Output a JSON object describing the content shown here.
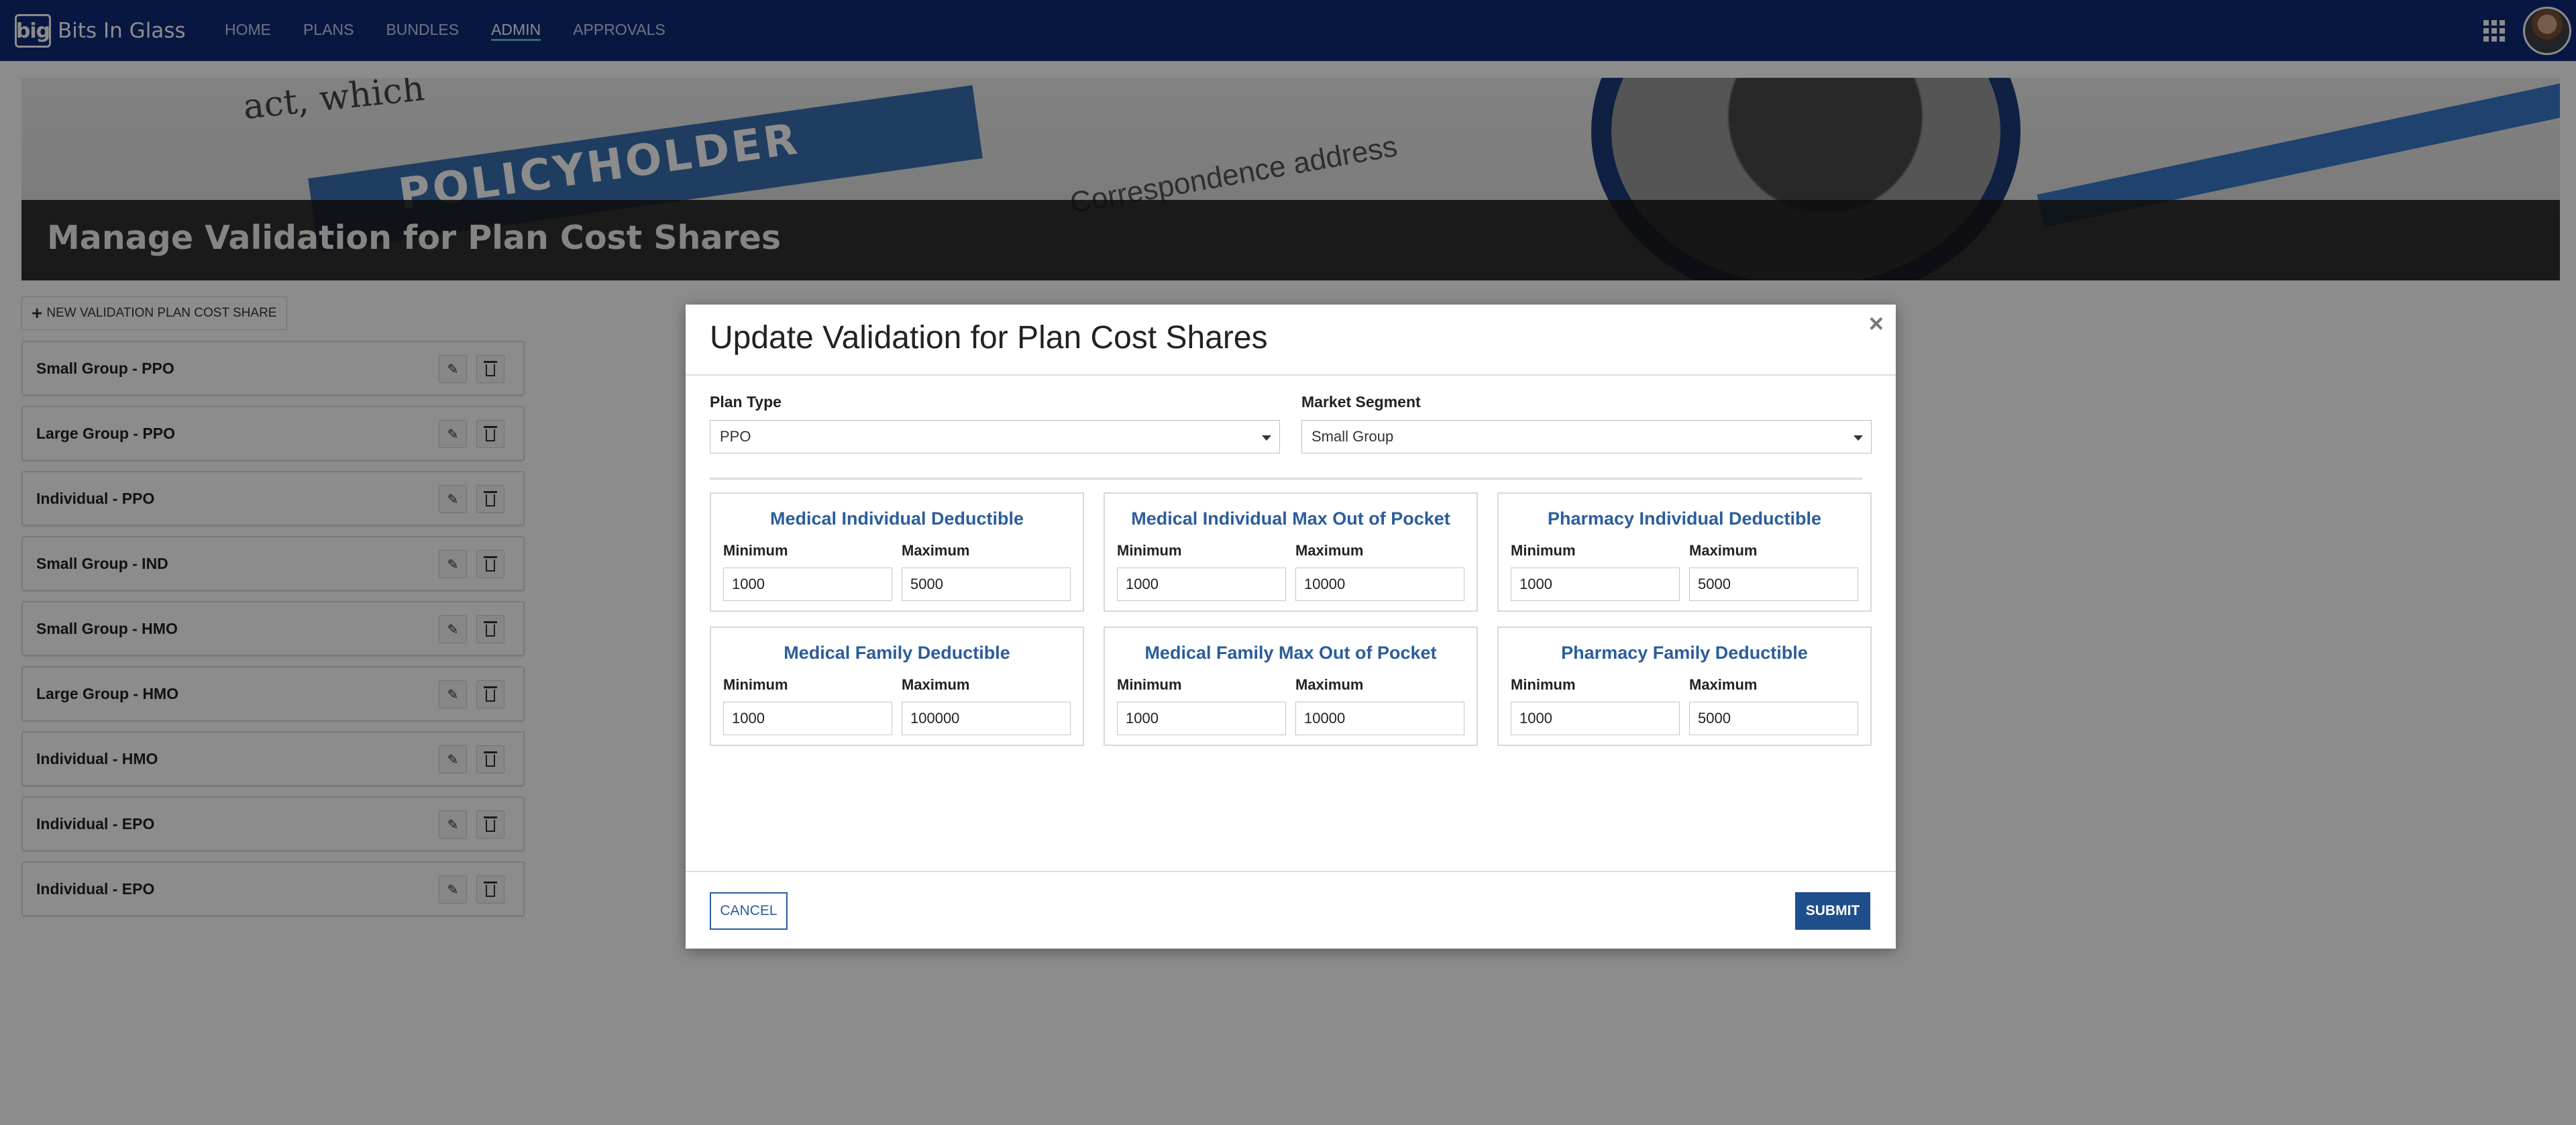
{
  "brand": {
    "logo_text": "big",
    "name": "Bits In Glass"
  },
  "nav": {
    "items": [
      "HOME",
      "PLANS",
      "BUNDLES",
      "ADMIN",
      "APPROVALS"
    ],
    "active": "ADMIN"
  },
  "hero": {
    "title": "Manage Validation for Plan Cost Shares",
    "photo_texts": [
      "POLICYHOLDER",
      "Correspondence address",
      "act, which"
    ]
  },
  "list": {
    "new_button_label": "NEW VALIDATION PLAN COST SHARE",
    "items": [
      "Small Group - PPO",
      "Large Group - PPO",
      "Individual - PPO",
      "Small Group - IND",
      "Small Group - HMO",
      "Large Group - HMO",
      "Individual - HMO",
      "Individual - EPO",
      "Individual - EPO"
    ]
  },
  "modal": {
    "title": "Update Validation for Plan Cost Shares",
    "close_symbol": "×",
    "plan_type": {
      "label": "Plan Type",
      "value": "PPO"
    },
    "market_segment": {
      "label": "Market Segment",
      "value": "Small Group"
    },
    "cards": [
      {
        "title": "Medical Individual Deductible",
        "min_label": "Minimum",
        "max_label": "Maximum",
        "min": "1000",
        "max": "5000"
      },
      {
        "title": "Medical Individual Max Out of Pocket",
        "min_label": "Minimum",
        "max_label": "Maximum",
        "min": "1000",
        "max": "10000"
      },
      {
        "title": "Pharmacy Individual Deductible",
        "min_label": "Minimum",
        "max_label": "Maximum",
        "min": "1000",
        "max": "5000"
      },
      {
        "title": "Medical Family Deductible",
        "min_label": "Minimum",
        "max_label": "Maximum",
        "min": "1000",
        "max": "100000"
      },
      {
        "title": "Medical Family Max Out of Pocket",
        "min_label": "Minimum",
        "max_label": "Maximum",
        "min": "1000",
        "max": "10000"
      },
      {
        "title": "Pharmacy Family Deductible",
        "min_label": "Minimum",
        "max_label": "Maximum",
        "min": "1000",
        "max": "5000"
      }
    ],
    "cancel_label": "CANCEL",
    "submit_label": "SUBMIT"
  },
  "colors": {
    "nav_bg": "#0f2a78",
    "accent_blue": "#2b5d9a",
    "submit_bg": "#1e4e8c"
  }
}
